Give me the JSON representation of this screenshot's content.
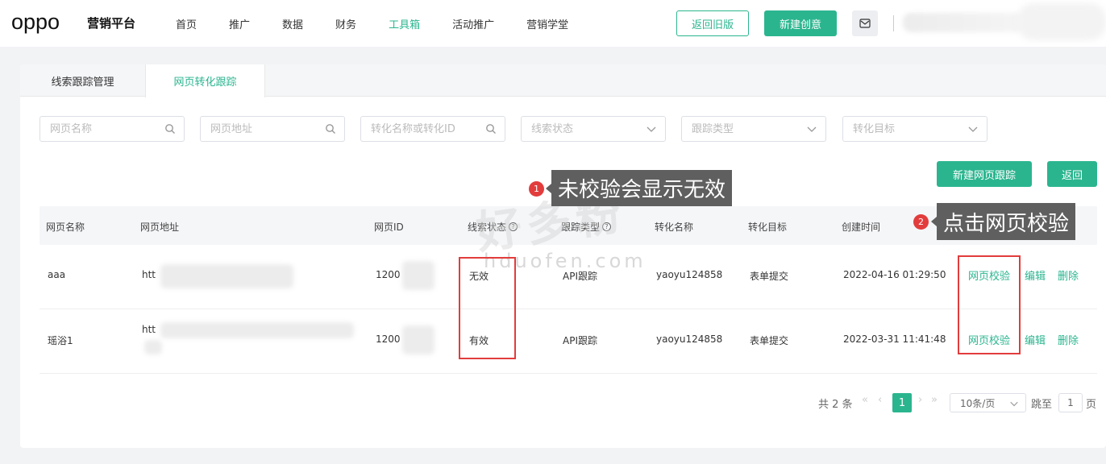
{
  "header": {
    "logo": "oppo",
    "brand": "营销平台",
    "nav": [
      {
        "label": "首页",
        "active": false
      },
      {
        "label": "推广",
        "active": false
      },
      {
        "label": "数据",
        "active": false
      },
      {
        "label": "财务",
        "active": false
      },
      {
        "label": "工具箱",
        "active": true
      },
      {
        "label": "活动推广",
        "active": false
      },
      {
        "label": "营销学堂",
        "active": false
      }
    ],
    "back_old_label": "返回旧版",
    "new_creative_label": "新建创意",
    "mail_icon": "mail-icon"
  },
  "tabs": {
    "tab1": "线索跟踪管理",
    "tab2": "网页转化跟踪"
  },
  "filters": {
    "page_name": "网页名称",
    "page_url": "网页地址",
    "conversion": "转化名称或转化ID",
    "lead_status": "线索状态",
    "track_type": "跟踪类型",
    "conv_target": "转化目标"
  },
  "actions": {
    "new_track": "新建网页跟踪",
    "back": "返回"
  },
  "table": {
    "headers": {
      "name": "网页名称",
      "url": "网页地址",
      "id": "网页ID",
      "status": "线索状态",
      "type": "跟踪类型",
      "conv_name": "转化名称",
      "conv_target": "转化目标",
      "created": "创建时间"
    },
    "rows": [
      {
        "name": "aaa",
        "url": "htt",
        "id": "1200",
        "status": "无效",
        "type": "API跟踪",
        "conv_name": "yaoyu124858",
        "conv_target": "表单提交",
        "created": "2022-04-16 01:29:50",
        "verify": "网页校验",
        "edit": "编辑",
        "delete": "删除"
      },
      {
        "name": "瑶浴1",
        "url": "htt",
        "id": "1200",
        "status": "有效",
        "type": "API跟踪",
        "conv_name": "yaoyu124858",
        "conv_target": "表单提交",
        "created": "2022-03-31 11:41:48",
        "verify": "网页校验",
        "edit": "编辑",
        "delete": "删除"
      }
    ]
  },
  "pagination": {
    "total": "共 2 条",
    "current": "1",
    "page_size": "10条/页",
    "jump_prefix": "跳至",
    "jump_value": "1",
    "jump_suffix": "页"
  },
  "annotations": {
    "callout1_num": "1",
    "callout1_text": "未校验会显示无效",
    "callout2_num": "2",
    "callout2_text": "点击网页校验",
    "watermark_cn": "好多粉",
    "watermark_en": "hduofen.com",
    "accent": "#e23c3c"
  },
  "colors": {
    "brand_green": "#2bb58f"
  }
}
